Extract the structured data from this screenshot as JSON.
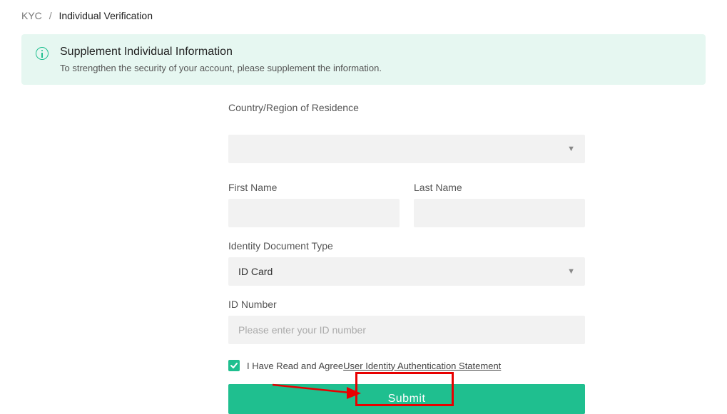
{
  "breadcrumb": {
    "parent": "KYC",
    "current": "Individual Verification"
  },
  "banner": {
    "title": "Supplement Individual Information",
    "subtitle": "To strengthen the security of your account, please supplement the information."
  },
  "form": {
    "country_label": "Country/Region of Residence",
    "country_value": "",
    "first_name_label": "First Name",
    "first_name_value": "",
    "last_name_label": "Last Name",
    "last_name_value": "",
    "doc_type_label": "Identity Document Type",
    "doc_type_value": "ID Card",
    "id_number_label": "ID Number",
    "id_number_placeholder": "Please enter your ID number",
    "id_number_value": ""
  },
  "agree": {
    "checked": true,
    "prefix": "I Have Read and Agree",
    "link": "User Identity Authentication Statement"
  },
  "submit_label": "Submit"
}
